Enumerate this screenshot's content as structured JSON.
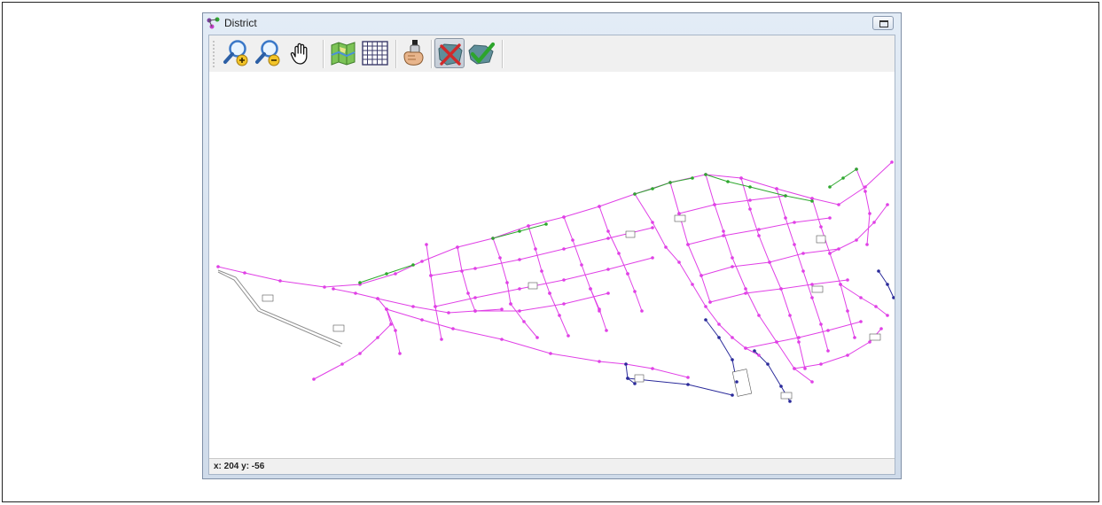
{
  "window": {
    "title": "District",
    "icon": "district-network-icon"
  },
  "toolbar": {
    "items": [
      {
        "name": "zoom-in",
        "icon": "magnifier-plus-icon",
        "pressed": false
      },
      {
        "name": "zoom-out",
        "icon": "magnifier-minus-icon",
        "pressed": false
      },
      {
        "name": "pan",
        "icon": "hand-icon",
        "pressed": false
      },
      {
        "name": "map-layer",
        "icon": "map-icon",
        "pressed": false
      },
      {
        "name": "grid",
        "icon": "grid-icon",
        "pressed": false
      },
      {
        "name": "spray-tool",
        "icon": "spray-can-icon",
        "pressed": false
      },
      {
        "name": "reject",
        "icon": "cross-icon",
        "pressed": true
      },
      {
        "name": "accept",
        "icon": "checkmark-icon",
        "pressed": false
      }
    ]
  },
  "status": {
    "coordinates": "x: 204 y: -56"
  },
  "colors": {
    "network_main": "#e040e6",
    "network_green": "#2ea82e",
    "network_blue": "#2a2a9a",
    "network_gray": "#8c8c8c",
    "window_chrome": "#d6e1ee"
  }
}
